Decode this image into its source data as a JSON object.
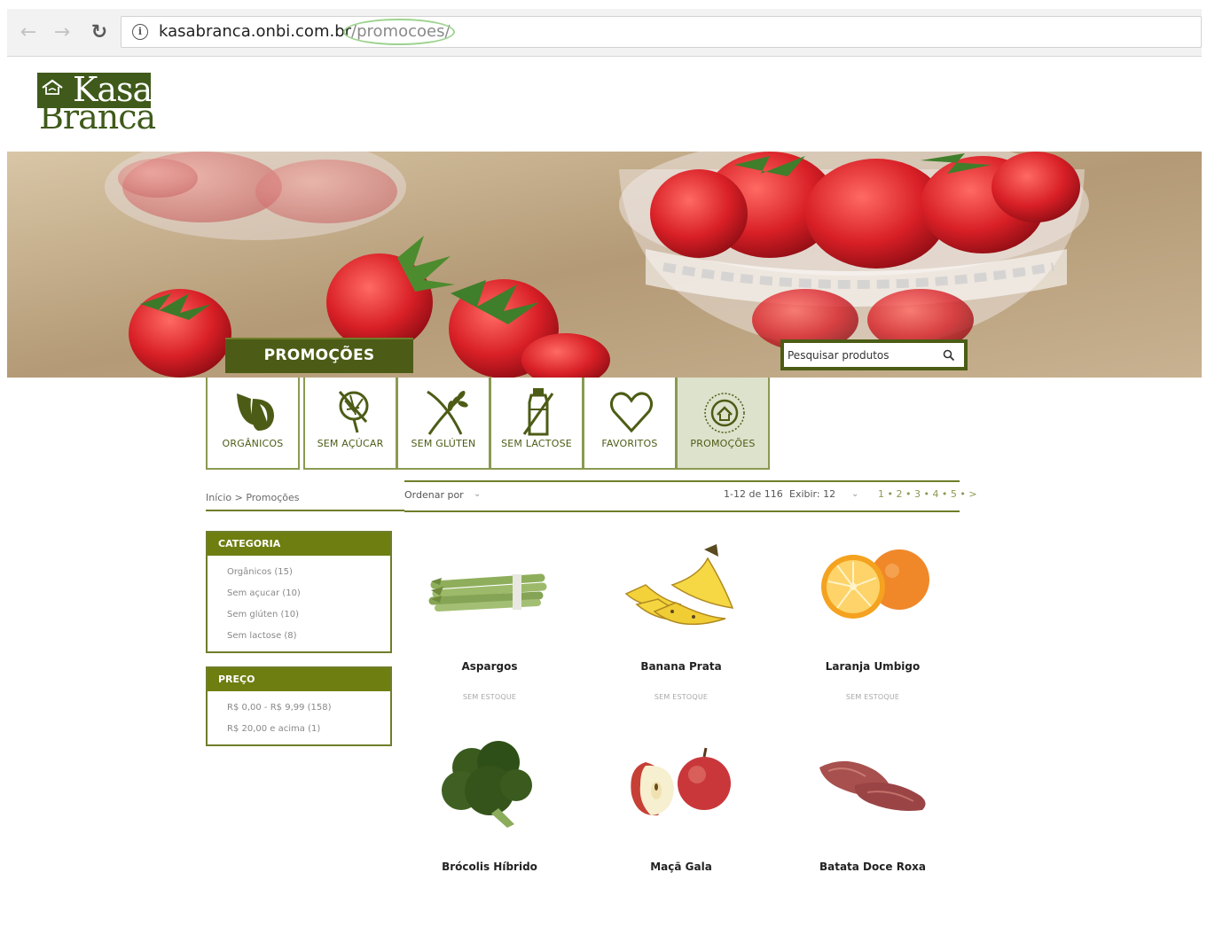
{
  "browser": {
    "back_icon": "back-arrow-icon",
    "forward_icon": "forward-arrow-icon",
    "reload_icon": "reload-icon",
    "url_host": "kasabranca.onbi.com.br",
    "url_path": "/promocoes/"
  },
  "logo": {
    "line1": "Kasa",
    "line2": "Branca"
  },
  "banner": {
    "title": "PROMOÇÕES",
    "search_placeholder": "Pesquisar produtos"
  },
  "categories": [
    {
      "label": "ORGÂNICOS",
      "icon": "organic-leaf-icon"
    },
    {
      "label": "SEM AÇÚCAR",
      "icon": "no-sugar-icon"
    },
    {
      "label": "SEM GLÚTEN",
      "icon": "no-gluten-wheat-icon"
    },
    {
      "label": "SEM LACTOSE",
      "icon": "no-lactose-bottle-icon"
    },
    {
      "label": "FAVORITOS",
      "icon": "heart-icon"
    },
    {
      "label": "PROMOÇÕES",
      "icon": "promo-seal-icon"
    }
  ],
  "breadcrumb": {
    "home": "Início",
    "separator": ">",
    "current": "Promoções"
  },
  "toolbar": {
    "sort_label": "Ordenar por",
    "count": "1-12 de 116",
    "show_label": "Exibir:",
    "show_value": "12",
    "pagination": "1 • 2 • 3 • 4 • 5 • >"
  },
  "filters": {
    "category": {
      "title": "CATEGORIA",
      "items": [
        "Orgânicos (15)",
        "Sem açucar (10)",
        "Sem glúten (10)",
        "Sem lactose (8)"
      ]
    },
    "price": {
      "title": "PREÇO",
      "items": [
        "R$ 0,00 - R$ 9,99 (158)",
        "R$ 20,00 e acima (1)"
      ]
    }
  },
  "products": [
    {
      "name": "Aspargos",
      "status": "SEM ESTOQUE"
    },
    {
      "name": "Banana Prata",
      "status": "SEM ESTOQUE"
    },
    {
      "name": "Laranja Umbigo",
      "status": "SEM ESTOQUE"
    },
    {
      "name": "Brócolis Híbrido",
      "status": ""
    },
    {
      "name": "Maçã Gala",
      "status": ""
    },
    {
      "name": "Batata Doce Roxa",
      "status": ""
    }
  ],
  "colors": {
    "brand_green": "#4c5c16",
    "accent_green": "#6e7e10",
    "url_highlight": "#9dd38f"
  }
}
